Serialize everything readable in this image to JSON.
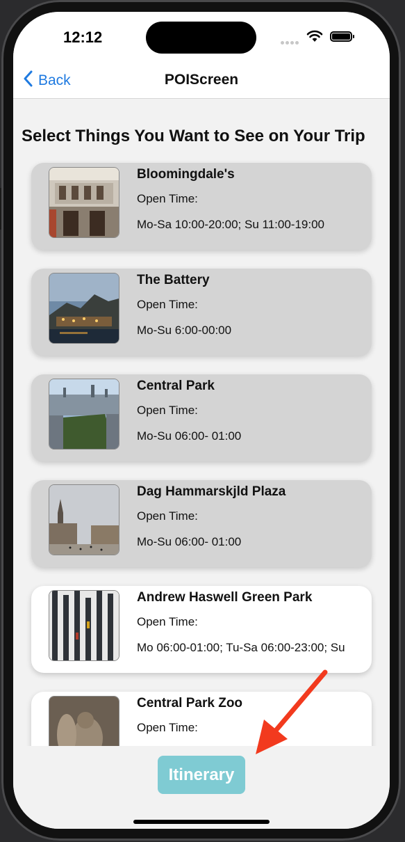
{
  "status_bar": {
    "time": "12:12"
  },
  "nav": {
    "back_label": "Back",
    "title": "POIScreen"
  },
  "page_heading": "Select Things You Want to See on Your Trip",
  "pois": [
    {
      "name": "Bloomingdale's",
      "open_label": "Open Time:",
      "hours": "Mo-Sa 10:00-20:00; Su 11:00-19:00",
      "selected": true
    },
    {
      "name": "The Battery",
      "open_label": "Open Time:",
      "hours": "Mo-Su 6:00-00:00",
      "selected": true
    },
    {
      "name": "Central Park",
      "open_label": "Open Time:",
      "hours": "Mo-Su 06:00- 01:00",
      "selected": true
    },
    {
      "name": "Dag Hammarskjld Plaza",
      "open_label": "Open Time:",
      "hours": "Mo-Su 06:00- 01:00",
      "selected": true
    },
    {
      "name": "Andrew Haswell Green Park",
      "open_label": "Open Time:",
      "hours": "Mo 06:00-01:00; Tu-Sa 06:00-23:00; Su",
      "selected": false
    },
    {
      "name": "Central Park Zoo",
      "open_label": "Open Time:",
      "hours": "",
      "selected": false
    }
  ],
  "itinerary_button": "Itinerary",
  "colors": {
    "accent": "#1f7ae0",
    "button": "#7fcbd3",
    "selected_card": "#d4d4d4",
    "unselected_card": "#ffffff",
    "annotation_arrow": "#f23a1e"
  }
}
